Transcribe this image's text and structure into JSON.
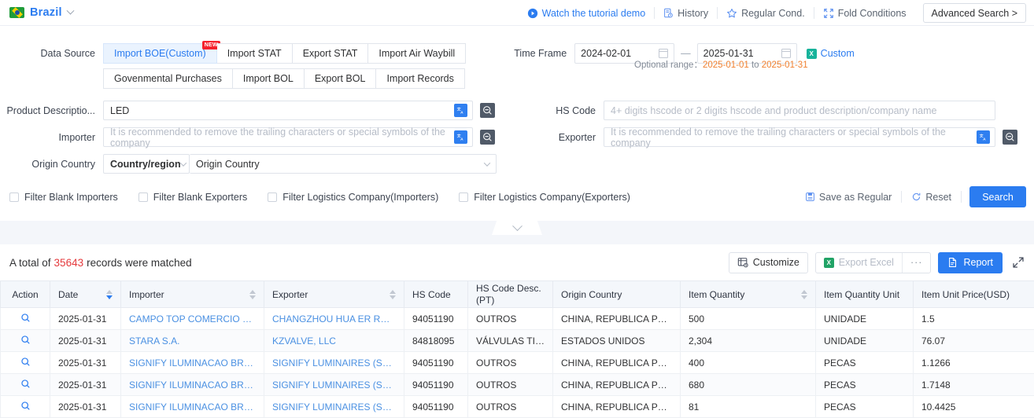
{
  "topbar": {
    "country": "Brazil",
    "flag_icon": "brazil-flag-icon",
    "links": [
      {
        "label": "Watch the tutorial demo",
        "icon": "play-circle-icon"
      },
      {
        "label": "History",
        "icon": "history-icon"
      },
      {
        "label": "Regular Cond.",
        "icon": "star-icon"
      },
      {
        "label": "Fold Conditions",
        "icon": "fold-icon"
      }
    ],
    "advanced_search": "Advanced Search >"
  },
  "form": {
    "data_source_label": "Data Source",
    "tabs_row1": [
      {
        "label": "Import BOE(Custom)",
        "active": true,
        "badge": "NEW"
      },
      {
        "label": "Import STAT",
        "active": false,
        "badge": ""
      },
      {
        "label": "Export STAT",
        "active": false,
        "badge": ""
      },
      {
        "label": "Import Air Waybill",
        "active": false,
        "badge": ""
      }
    ],
    "tabs_row2": [
      {
        "label": "Govenmental Purchases"
      },
      {
        "label": "Import BOL"
      },
      {
        "label": "Export BOL"
      },
      {
        "label": "Import Records"
      }
    ],
    "time_frame_label": "Time Frame",
    "optional_range_prefix": "Optional range：",
    "optional_range_start": "2025-01-01",
    "optional_range_mid": " to ",
    "optional_range_end": "2025-01-31",
    "date_start": "2024-02-01",
    "date_end": "2025-01-31",
    "date_separator": "—",
    "custom_label": "Custom",
    "product_desc_label": "Product Descriptio...",
    "product_desc_value": "LED",
    "hs_code_label": "HS Code",
    "hs_code_placeholder": "4+ digits hscode or 2 digits hscode and product description/company name",
    "importer_label": "Importer",
    "importer_placeholder": "It is recommended to remove the trailing characters or special symbols of the company",
    "exporter_label": "Exporter",
    "exporter_placeholder": "It is recommended to remove the trailing characters or special symbols of the company",
    "origin_country_label": "Origin Country",
    "origin_country_select": "Country/region",
    "origin_country_placeholder": "Origin Country",
    "translate_icon": "translate-icon",
    "translate_glyph": "文A",
    "zoomout_icon": "magnifier-minus-icon",
    "checkboxes": [
      "Filter Blank Importers",
      "Filter Blank Exporters",
      "Filter Logistics Company(Importers)",
      "Filter Logistics Company(Exporters)"
    ],
    "save_regular": "Save as Regular",
    "reset": "Reset",
    "search": "Search",
    "collapse_icon": "chevron-down-icon"
  },
  "results": {
    "total_prefix": "A total of",
    "total_count": "35643",
    "total_suffix": "records were matched",
    "customize": "Customize",
    "export_excel": "Export Excel",
    "more": "···",
    "report": "Report",
    "expand_icon": "expand-icon"
  },
  "table": {
    "columns": [
      {
        "label": "Action",
        "sortable": false
      },
      {
        "label": "Date",
        "sortable": true,
        "active": true
      },
      {
        "label": "Importer",
        "sortable": true
      },
      {
        "label": "Exporter",
        "sortable": true
      },
      {
        "label": "HS Code",
        "sortable": false
      },
      {
        "label": "HS Code Desc. (PT)",
        "sortable": false
      },
      {
        "label": "Origin Country",
        "sortable": false
      },
      {
        "label": "Item Quantity",
        "sortable": true
      },
      {
        "label": "Item Quantity Unit",
        "sortable": false
      },
      {
        "label": "Item Unit Price(USD)",
        "sortable": false
      }
    ],
    "action_icon": "search-magnifier-icon",
    "rows": [
      {
        "date": "2025-01-31",
        "importer": "CAMPO TOP COMERCIO DE EL...",
        "exporter": "CHANGZHOU HUA ER RUI INT...",
        "hs_code": "94051190",
        "hs_desc": "OUTROS",
        "origin": "CHINA, REPUBLICA POPULA",
        "qty": "500",
        "unit": "UNIDADE",
        "price": "1.5"
      },
      {
        "date": "2025-01-31",
        "importer": "STARA S.A.",
        "exporter": "KZVALVE, LLC",
        "hs_code": "84818095",
        "hs_desc": "VÁLVULAS TIPO ...",
        "origin": "ESTADOS UNIDOS",
        "qty": "2,304",
        "unit": "UNIDADE",
        "price": "76.07"
      },
      {
        "date": "2025-01-31",
        "importer": "SIGNIFY ILUMINACAO BRASIL ...",
        "exporter": "SIGNIFY LUMINAIRES (SHAN...",
        "hs_code": "94051190",
        "hs_desc": "OUTROS",
        "origin": "CHINA, REPUBLICA POPULA",
        "qty": "400",
        "unit": "PECAS",
        "price": "1.1266"
      },
      {
        "date": "2025-01-31",
        "importer": "SIGNIFY ILUMINACAO BRASIL ...",
        "exporter": "SIGNIFY LUMINAIRES (SHAN...",
        "hs_code": "94051190",
        "hs_desc": "OUTROS",
        "origin": "CHINA, REPUBLICA POPULA",
        "qty": "680",
        "unit": "PECAS",
        "price": "1.7148"
      },
      {
        "date": "2025-01-31",
        "importer": "SIGNIFY ILUMINACAO BRASIL ...",
        "exporter": "SIGNIFY LUMINAIRES (SHAN...",
        "hs_code": "94051190",
        "hs_desc": "OUTROS",
        "origin": "CHINA, REPUBLICA POPULA",
        "qty": "81",
        "unit": "PECAS",
        "price": "10.4425"
      }
    ]
  },
  "colors": {
    "accent": "#2b7cf0",
    "link": "#4a90e2",
    "danger": "#e4393c",
    "range": "#f08030",
    "excel_green": "#21a366"
  }
}
